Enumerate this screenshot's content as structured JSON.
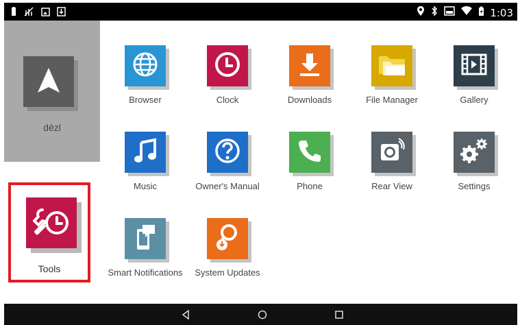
{
  "status_bar": {
    "time": "1:03",
    "left_icons": [
      "battery-icon",
      "no-signal-icon",
      "image-icon",
      "download-icon"
    ],
    "right_icons": [
      "location-icon",
      "bluetooth-icon",
      "cast-icon",
      "wifi-icon",
      "battery-charging-icon"
    ]
  },
  "left_panel": {
    "app_label": "dēzl",
    "bg_color": "#a9a9a9"
  },
  "tools": {
    "label": "Tools",
    "color": "#c0164a",
    "highlight_color": "#e21c21"
  },
  "apps": [
    {
      "label": "Browser",
      "icon": "globe-icon",
      "color": "#2a95d4"
    },
    {
      "label": "Clock",
      "icon": "clock-icon",
      "color": "#c0164a"
    },
    {
      "label": "Downloads",
      "icon": "download-icon",
      "color": "#ea6d1b"
    },
    {
      "label": "File Manager",
      "icon": "folder-icon",
      "color": "#d6a800"
    },
    {
      "label": "Gallery",
      "icon": "film-icon",
      "color": "#2c3f4a"
    },
    {
      "label": "Music",
      "icon": "music-note-icon",
      "color": "#1f6fc8"
    },
    {
      "label": "Owner's Manual",
      "icon": "help-icon",
      "color": "#1f6fc8"
    },
    {
      "label": "Phone",
      "icon": "phone-icon",
      "color": "#4caf50"
    },
    {
      "label": "Rear View",
      "icon": "camera-icon",
      "color": "#596268"
    },
    {
      "label": "Settings",
      "icon": "gears-icon",
      "color": "#596268"
    },
    {
      "label": "Smart Notifications",
      "icon": "phone-notification-icon",
      "color": "#5b8fa5"
    },
    {
      "label": "System Updates",
      "icon": "map-pin-update-icon",
      "color": "#ea6d1b"
    }
  ],
  "nav_bar": {
    "buttons": [
      "back-icon",
      "home-icon",
      "recents-icon"
    ]
  }
}
